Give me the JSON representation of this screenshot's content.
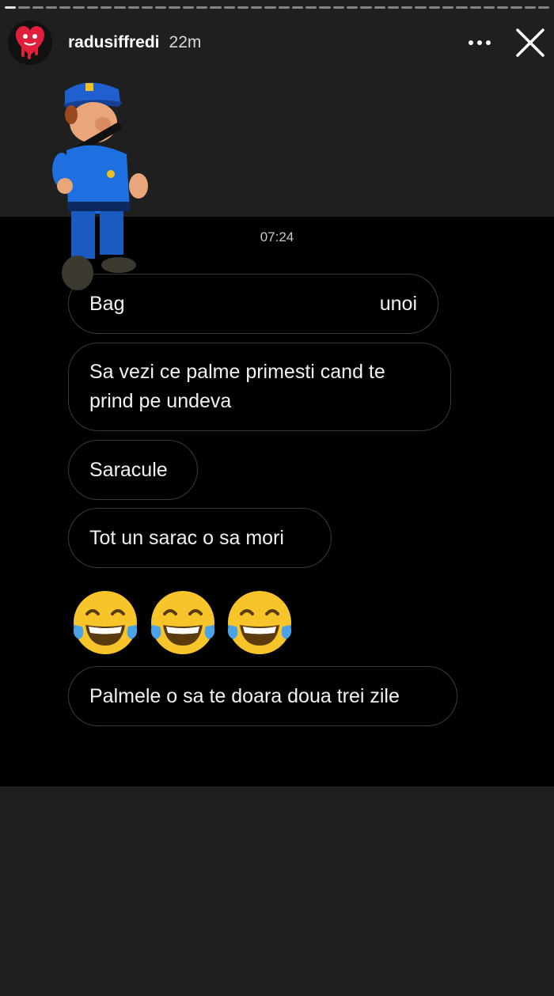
{
  "header": {
    "username": "radusiffredi",
    "time": "22m",
    "more_label": "•••"
  },
  "progress": {
    "segments": 40,
    "active_index": 0
  },
  "screenshot": {
    "timestamp": "07:24",
    "messages": [
      {
        "text_left": "Bag",
        "text_right": "unoi",
        "redacted": true
      },
      {
        "text": "Sa vezi ce palme primesti cand te prind pe undeva"
      },
      {
        "text": "Saracule"
      },
      {
        "text": "Tot un sarac o sa mori"
      },
      {
        "emoji": [
          "face-with-tears-of-joy",
          "face-with-tears-of-joy",
          "face-with-tears-of-joy"
        ]
      },
      {
        "text": "Palmele o sa te doara doua trei zile"
      }
    ]
  },
  "sticker": {
    "name": "police-officer-sticker"
  },
  "colors": {
    "background": "#1f1f1f",
    "screenshot_bg": "#000000",
    "bubble_border": "#3a3a3a"
  }
}
